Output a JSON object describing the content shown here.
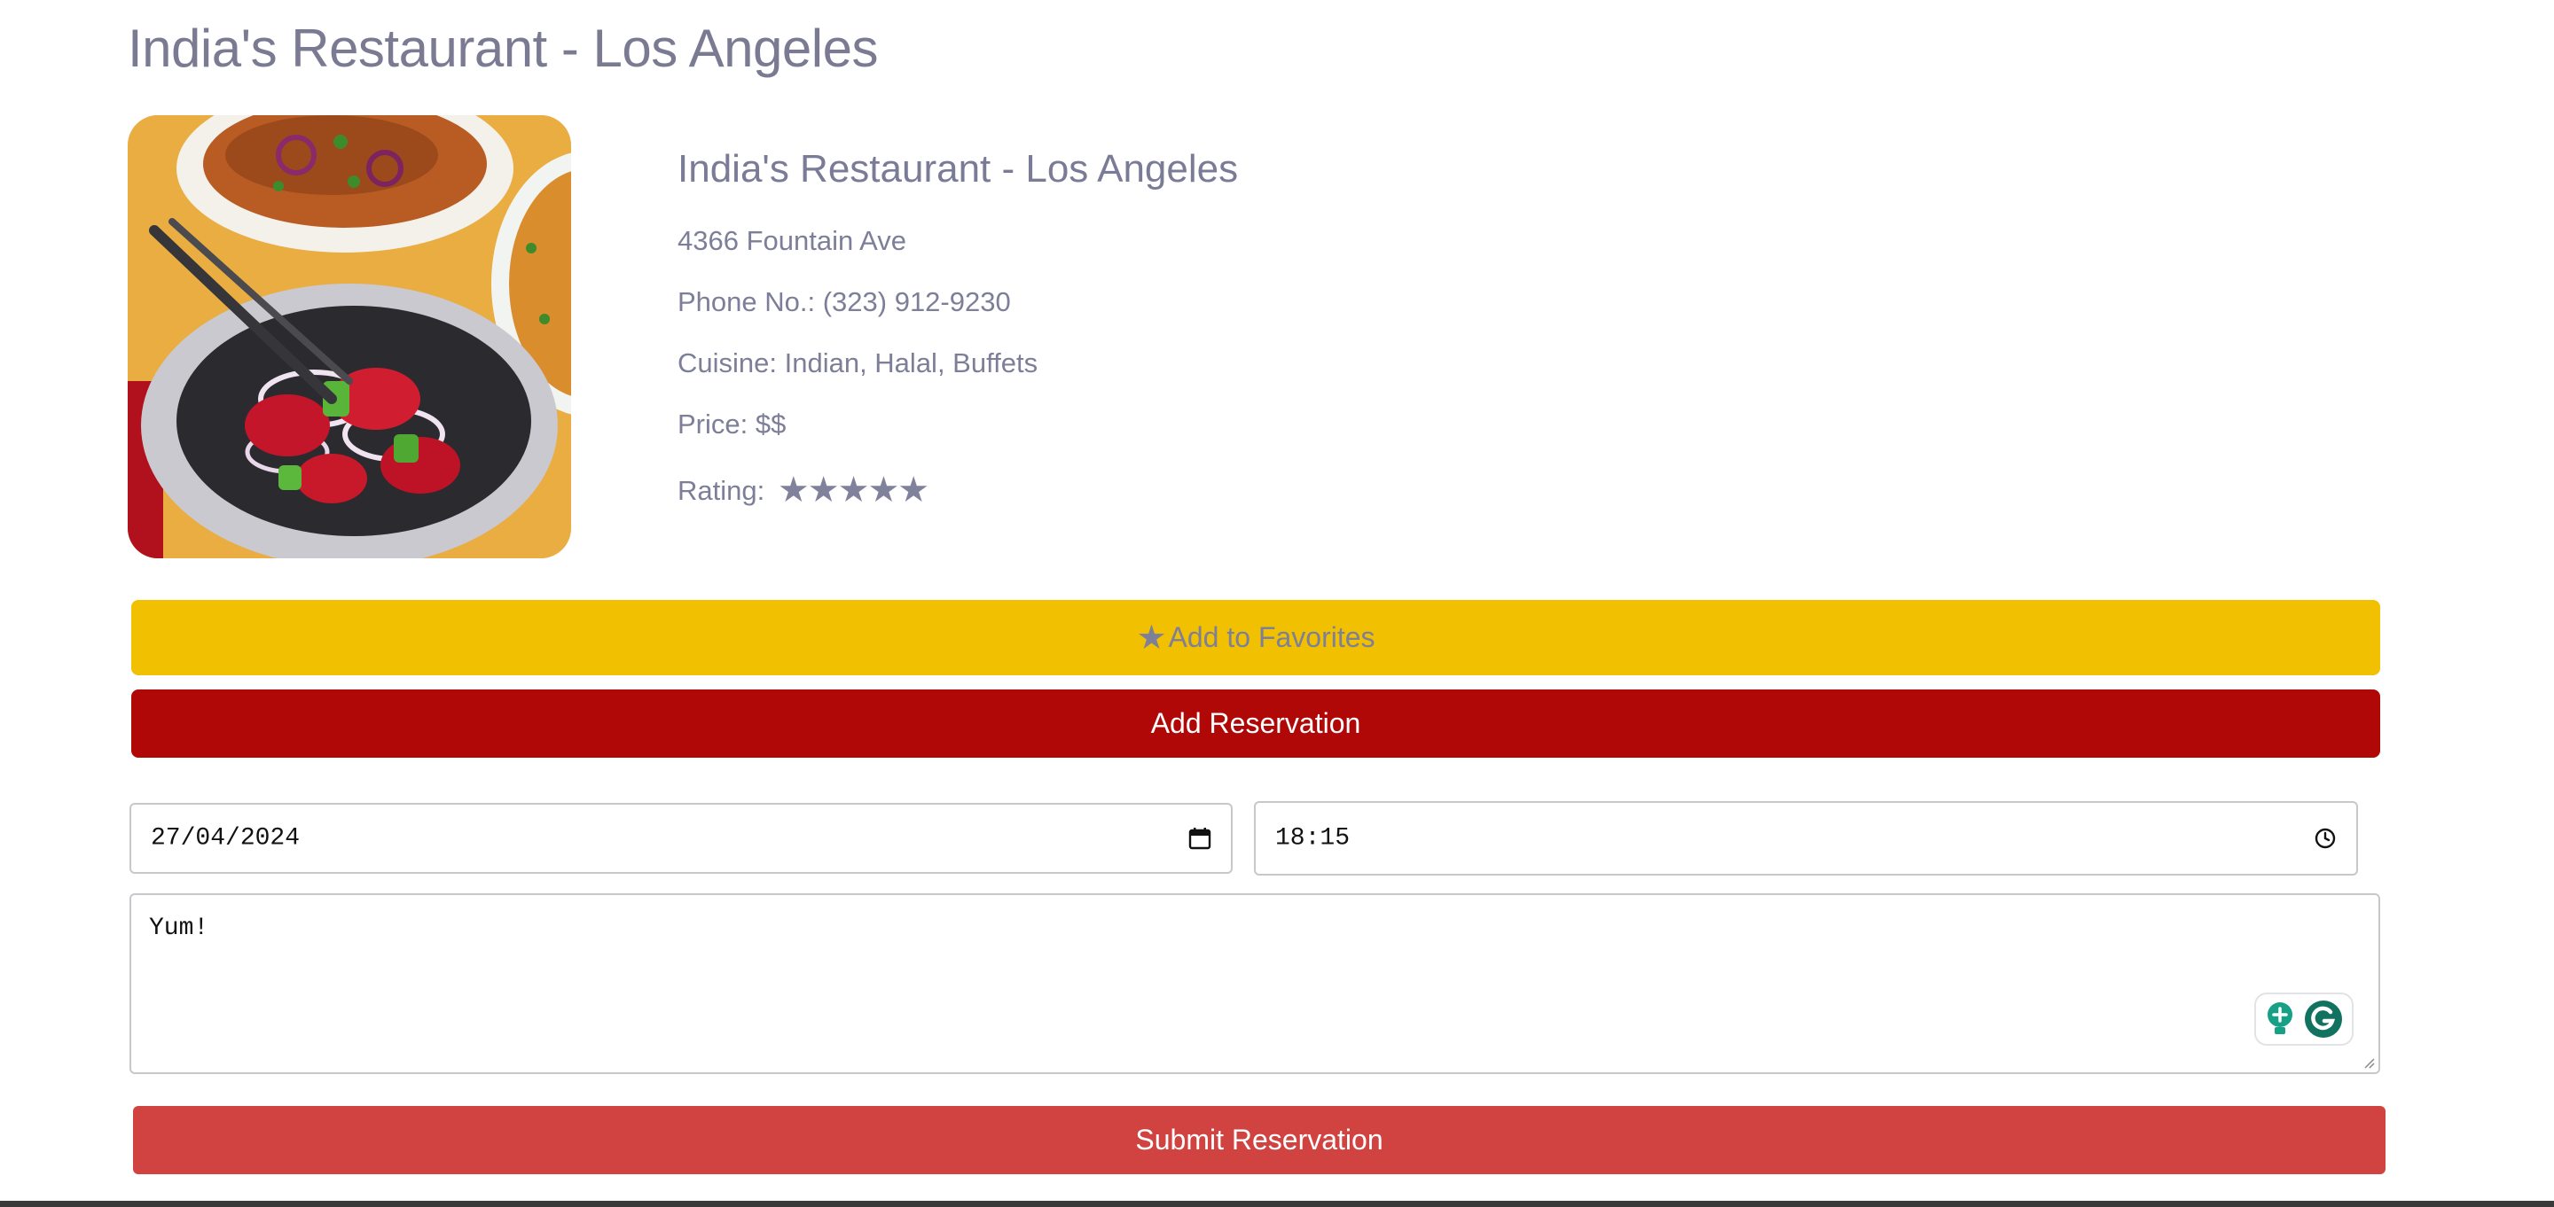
{
  "page": {
    "title": "India's Restaurant - Los Angeles"
  },
  "restaurant": {
    "name": "India's Restaurant - Los Angeles",
    "address": "4366 Fountain Ave",
    "phone": "Phone No.: (323) 912-9230",
    "cuisine": "Cuisine: Indian, Halal, Buffets",
    "price": "Price: $$",
    "rating_label": "Rating:",
    "rating_stars": 5,
    "rating_max": 5,
    "image_icon": "food-photo"
  },
  "actions": {
    "favorites_star": "★",
    "favorites_label": "Add to Favorites",
    "reservation_label": "Add Reservation",
    "submit_label": "Submit Reservation"
  },
  "form": {
    "date_value": "27/04/2024",
    "time_value": "18:15",
    "notes_value": "Yum!"
  },
  "colors": {
    "favorites": "#f1c000",
    "reservation": "#b00707",
    "submit": "#d14340",
    "text": "#7c7d96"
  }
}
